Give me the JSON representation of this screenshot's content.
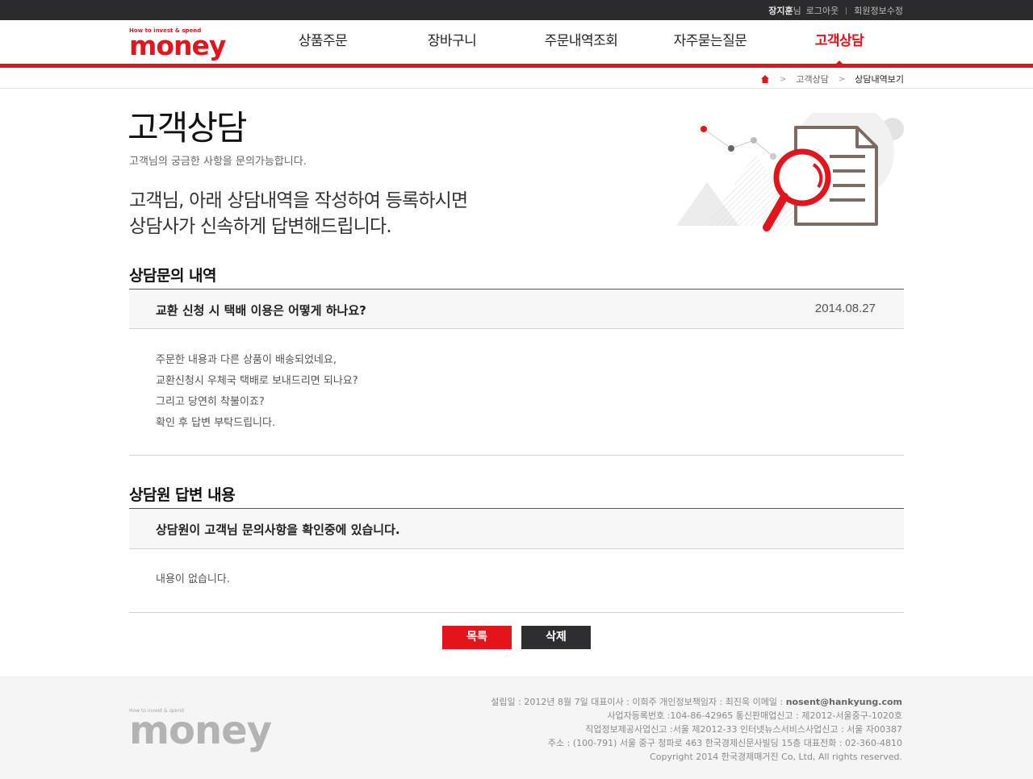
{
  "topbar": {
    "user_name": "장지훈",
    "user_suffix": "님",
    "logout": "로그아웃",
    "edit_profile": "회원정보수정"
  },
  "header": {
    "logo_tagline": "How to invest & spend",
    "logo_word": "money",
    "nav": [
      {
        "label": "상품주문"
      },
      {
        "label": "장바구니"
      },
      {
        "label": "주문내역조회"
      },
      {
        "label": "자주묻는질문"
      },
      {
        "label": "고객상담"
      }
    ],
    "active_nav": "고객상담",
    "accent_color": "#e4141b"
  },
  "breadcrumb": {
    "home_icon": "home-icon",
    "items": [
      "고객상담",
      "상담내역보기"
    ]
  },
  "intro": {
    "title": "고객상담",
    "subtitle": "고객님의 궁금한 사항을 문의가능합니다.",
    "lead_line1": "고객님, 아래 상담내역을 작성하여 등록하시면",
    "lead_line2": "상담사가 신속하게 답변해드립니다."
  },
  "inquiry": {
    "heading": "상담문의 내역",
    "question": "교환 신청 시 택배 이용은 어떻게 하나요?",
    "date": "2014.08.27",
    "body": [
      "주문한 내용과 다른 상품이 배송되었네요,",
      "교환신청시 우체국 택배로 보내드리면 되나요?",
      "그리고 당연히 착불이죠?",
      "확인 후 답변 부탁드립니다."
    ]
  },
  "answer": {
    "heading": "상담원 답변 내용",
    "status": "상담원이 고객님 문의사항을 확인중에 있습니다.",
    "body": "내용이 없습니다."
  },
  "buttons": {
    "list": "목록",
    "delete": "삭제"
  },
  "footer": {
    "logo_tagline": "How to invest & spend",
    "logo_word": "money",
    "line1_prefix": "설립일 : 2012년 8월 7일 대표이사 : 이희주 개인정보책임자 : 최진욱 이메일 : ",
    "email": "nosent@hankyung.com",
    "line2": "사업자등록번호 :104-86-42965 통신판매업신고 : 제2012-서울중구-1020호",
    "line3": "직업정보제공사업신고 :서울 제2012-33 인터넷뉴스서비스사업신고 : 서울 자00387",
    "line4": "주소 : (100-791) 서울 중구 청파로 463 한국경제신문사빌딩 15층 대표전화 : 02-360-4810",
    "line5": "Copyright 2014 한국경제매거진 Co, Ltd, All rights reserved."
  }
}
